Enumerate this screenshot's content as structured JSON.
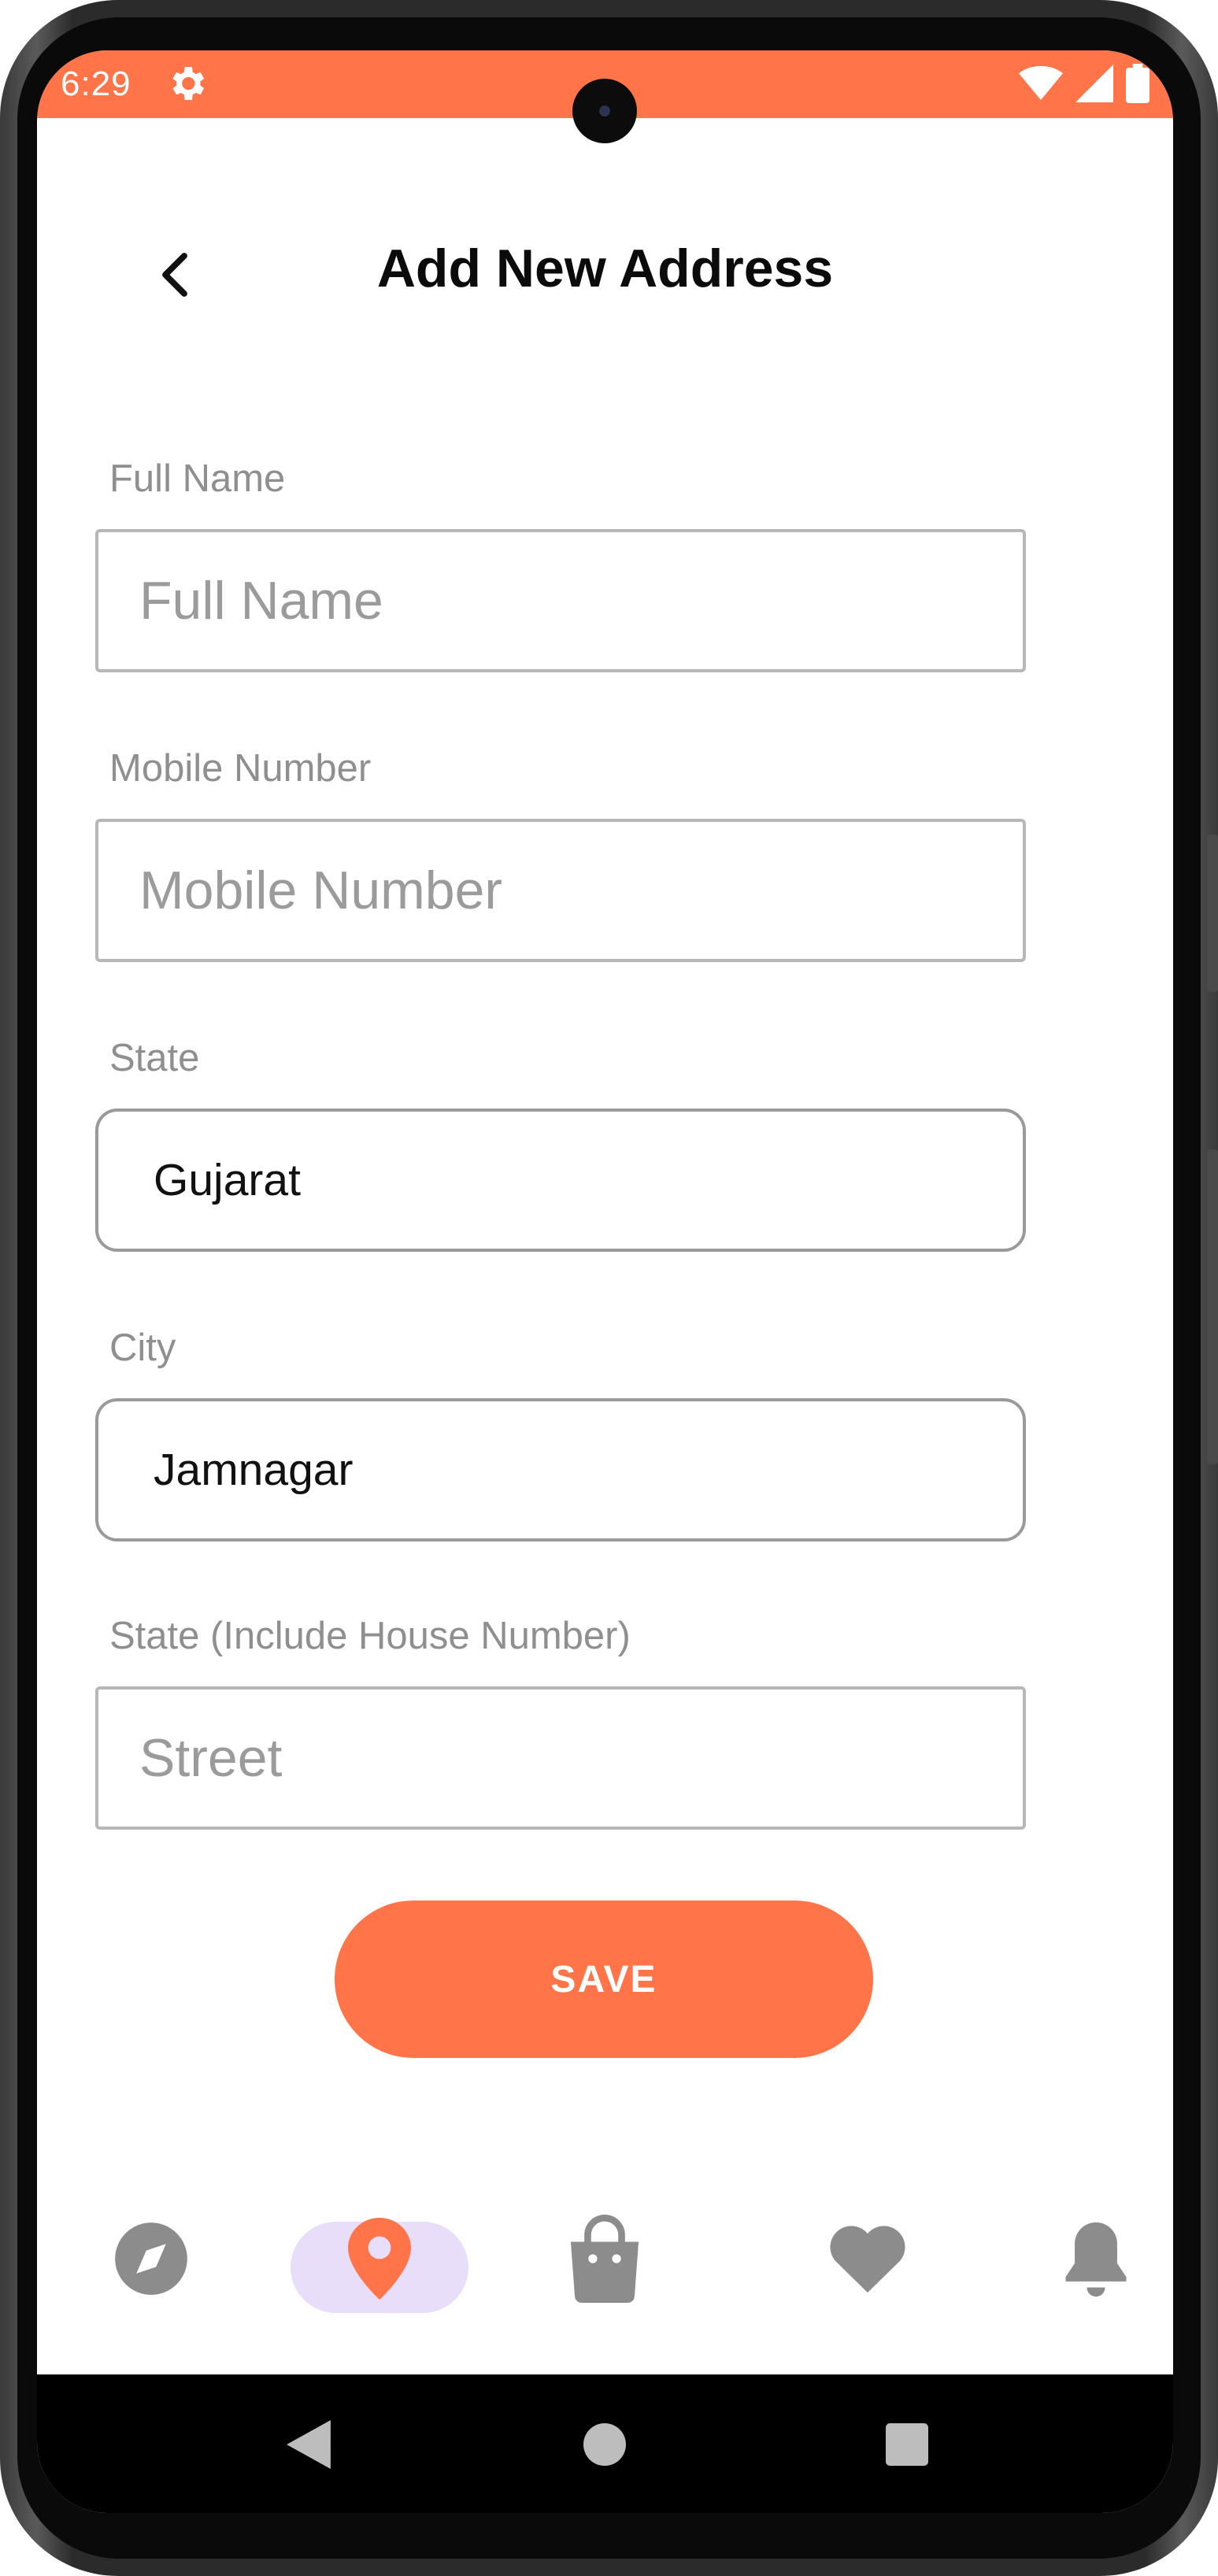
{
  "status_bar": {
    "time": "6:29",
    "icons": [
      "settings-gear-icon",
      "wifi-icon",
      "signal-icon",
      "battery-icon"
    ],
    "background_color": "#ff7549"
  },
  "header": {
    "title": "Add New Address",
    "back_icon": "chevron-left-icon"
  },
  "form": {
    "full_name": {
      "label": "Full Name",
      "placeholder": "Full Name",
      "value": ""
    },
    "mobile": {
      "label": "Mobile Number",
      "placeholder": "Mobile Number",
      "value": ""
    },
    "state": {
      "label": "State",
      "value": "Gujarat"
    },
    "city": {
      "label": "City",
      "value": "Jamnagar"
    },
    "street": {
      "label": "State (Include House Number)",
      "placeholder": "Street",
      "value": ""
    }
  },
  "save_button": {
    "label": "SAVE",
    "color": "#ff7549"
  },
  "bottom_nav": {
    "items": [
      {
        "icon": "compass-icon",
        "active": false
      },
      {
        "icon": "location-pin-icon",
        "active": true
      },
      {
        "icon": "shopping-bag-icon",
        "active": false
      },
      {
        "icon": "heart-icon",
        "active": false
      },
      {
        "icon": "bell-icon",
        "active": false
      }
    ],
    "active_color": "#ff7549",
    "active_pill_color": "#e8defa",
    "inactive_color": "#8c8c8c"
  },
  "system_nav": [
    "back-triangle-icon",
    "home-circle-icon",
    "recents-square-icon"
  ]
}
